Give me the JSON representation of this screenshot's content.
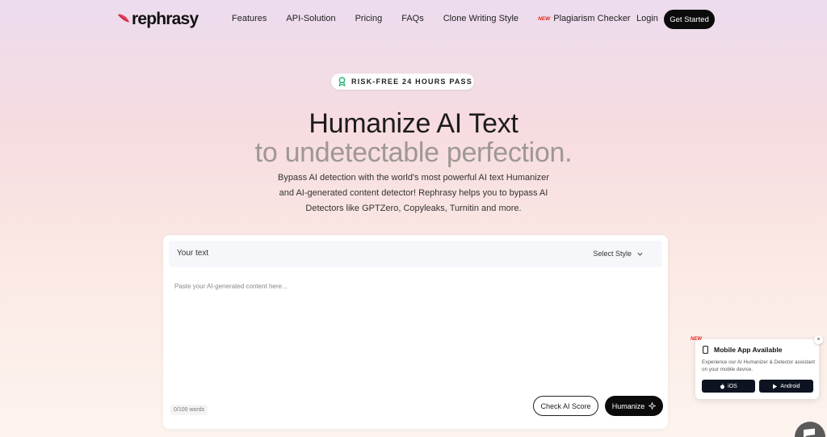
{
  "nav": {
    "logo": "rephrasy",
    "links": [
      "Features",
      "API-Solution",
      "Pricing",
      "FAQs",
      "Clone Writing Style"
    ],
    "new_badge": "NEW",
    "plagiarism": "Plagiarism Checker",
    "login": "Login",
    "cta": "Get Started"
  },
  "hero": {
    "badge": "RISK-FREE 24 HOURS PASS",
    "title": "Humanize AI Text",
    "subtitle": "to undetectable perfection.",
    "description": "Bypass AI detection with the world's most powerful AI text Humanizer and AI-generated content detector! Rephrasy helps you to bypass AI Detectors like GPTZero, Copyleaks, Turnitin and more."
  },
  "editor": {
    "label": "Your text",
    "style_select": "Select Style",
    "placeholder": "Paste your AI-generated content here...",
    "value": "",
    "word_count": "0/100 words",
    "check_button": "Check AI Score",
    "humanize_button": "Humanize"
  },
  "popup": {
    "new_badge": "NEW",
    "close": "×",
    "title": "Mobile App Available",
    "description": "Experience our AI Humanizer & Detector assistant on your mobile device.",
    "ios_label": "iOS",
    "android_label": "Android"
  },
  "icons": {
    "logo": "feather-icon",
    "badge": "award-ribbon-icon",
    "select": "chevron-down-icon",
    "humanize": "sparkle-icon",
    "popup": "phone-icon",
    "ios": "apple-icon",
    "android": "play-store-icon",
    "chat": "chat-icon"
  },
  "colors": {
    "accent_red": "#e0261b",
    "badge_green": "#2bb673",
    "dark_button": "#0b0b0b",
    "app_button": "#0d1321"
  }
}
